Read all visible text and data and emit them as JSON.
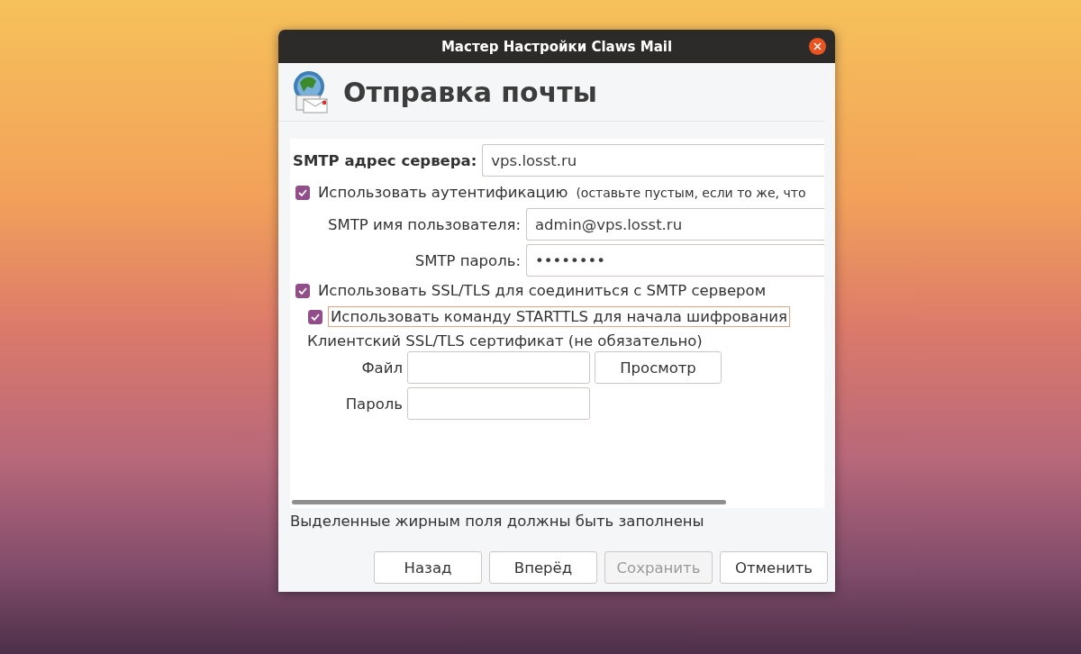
{
  "window": {
    "title": "Мастер Настройки Claws Mail"
  },
  "page_title": "Отправка почты",
  "server": {
    "label": "SMTP адрес сервера:",
    "value": "vps.losst.ru"
  },
  "auth": {
    "label": "Использовать аутентификацию",
    "hint": "(оставьте пустым, если то же, что",
    "checked": true,
    "focused": false
  },
  "auth_fields": [
    {
      "label": "SMTP имя пользователя:",
      "value": "admin@vps.losst.ru"
    },
    {
      "label": "SMTP пароль:",
      "value": "••••••••"
    }
  ],
  "ssl_options": [
    {
      "label": "Использовать SSL/TLS для соединиться с SMTP сервером",
      "checked": true,
      "focused": false,
      "indented": false
    },
    {
      "label": "Использовать команду STARTTLS для начала шифрования",
      "checked": true,
      "focused": true,
      "indented": true
    }
  ],
  "certificate": {
    "label": "Клиентский SSL/TLS сертификат (не обязательно)",
    "file_label": "Файл",
    "browse_button": "Просмотр",
    "password_label": "Пароль"
  },
  "required_note": "Выделенные жирным поля должны быть заполнены",
  "buttons": [
    {
      "label": "Назад",
      "disabled": false
    },
    {
      "label": "Вперёд",
      "disabled": false
    },
    {
      "label": "Сохранить",
      "disabled": true
    },
    {
      "label": "Отменить",
      "disabled": false
    }
  ]
}
